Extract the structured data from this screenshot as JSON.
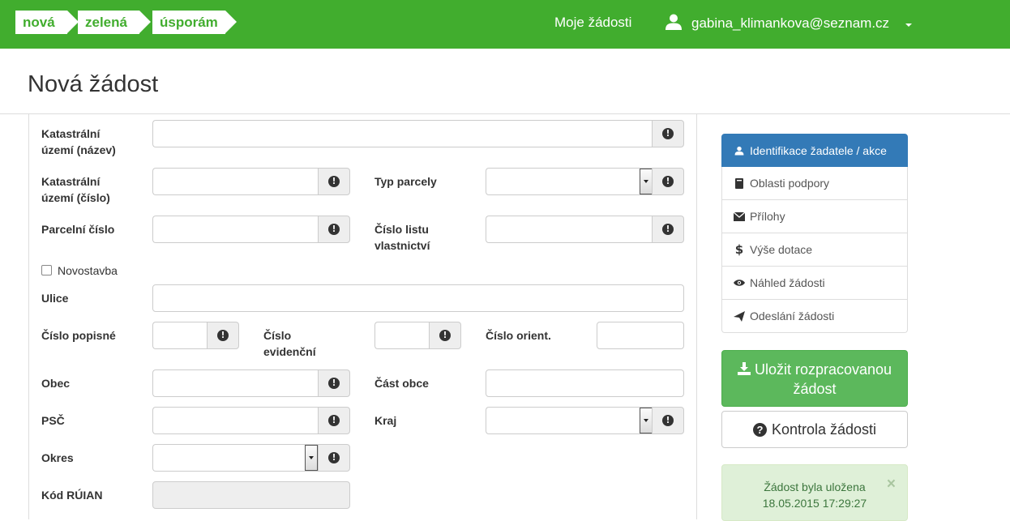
{
  "navbar": {
    "logo": [
      "nová",
      "zelená",
      "úsporám"
    ],
    "my_requests": "Moje žádosti",
    "user_email": "gabina_klimankova@seznam.cz"
  },
  "header": {
    "title": "Nová žádost"
  },
  "form": {
    "katastralni_uzemi_nazev_l1": "Katastrální",
    "katastralni_uzemi_nazev_l2": "území (název)",
    "katastralni_uzemi_cislo_l1": "Katastrální",
    "katastralni_uzemi_cislo_l2": "území (číslo)",
    "typ_parcely": "Typ parcely",
    "parcelni_cislo": "Parcelní číslo",
    "cislo_listu_l1": "Číslo listu",
    "cislo_listu_l2": "vlastnictví",
    "novostavba": "Novostavba",
    "ulice": "Ulice",
    "cislo_popisne": "Číslo popisné",
    "cislo_evidencni_l1": "Číslo",
    "cislo_evidencni_l2": "evidenční",
    "cislo_orient": "Číslo orient.",
    "obec": "Obec",
    "cast_obce": "Část obce",
    "psc": "PSČ",
    "kraj": "Kraj",
    "okres": "Okres",
    "kod_ruian": "Kód RÚIAN",
    "info_glyph": "!"
  },
  "sidebar": {
    "items": [
      {
        "label": "Identifikace žadatele / akce",
        "icon": "user-icon"
      },
      {
        "label": "Oblasti podpory",
        "icon": "book-icon"
      },
      {
        "label": "Přílohy",
        "icon": "envelope-icon"
      },
      {
        "label": "Výše dotace",
        "icon": "dollar-icon"
      },
      {
        "label": "Náhled žádosti",
        "icon": "eye-icon"
      },
      {
        "label": "Odeslání žádosti",
        "icon": "send-icon"
      }
    ],
    "save_l1": "Uložit rozpracovanou",
    "save_l2": "žádost",
    "check_label": "Kontrola žádosti",
    "alert_l1": "Žádost byla uložena",
    "alert_l2": "18.05.2015 17:29:27",
    "alert_close": "×"
  },
  "colors": {
    "brand": "#41ad2e",
    "primary": "#337ab7",
    "success": "#5cb85c"
  }
}
